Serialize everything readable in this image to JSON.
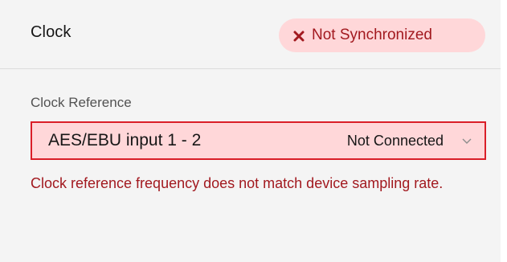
{
  "header": {
    "title": "Clock",
    "status_badge": {
      "icon": "x-icon",
      "label": "Not Synchronized"
    }
  },
  "clock_reference": {
    "label": "Clock Reference",
    "selected_value": "AES/EBU input 1 - 2",
    "connection_status": "Not Connected",
    "error_message": "Clock reference frequency does not match device sampling rate."
  },
  "colors": {
    "error_fill": "#ffd7d9",
    "error_border": "#da1e28",
    "error_text": "#a2191f",
    "panel_bg": "#f4f4f4"
  }
}
